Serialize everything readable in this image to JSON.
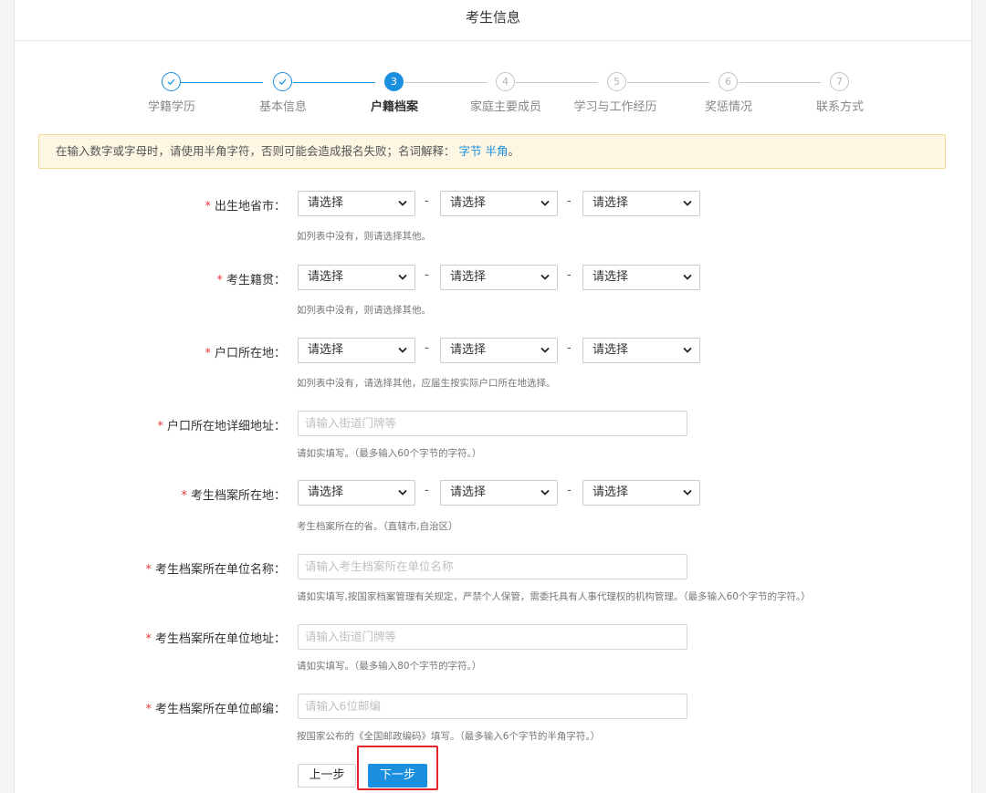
{
  "page": {
    "title": "考生信息"
  },
  "steps": [
    {
      "number": "1",
      "label": "学籍学历",
      "state": "done"
    },
    {
      "number": "2",
      "label": "基本信息",
      "state": "done"
    },
    {
      "number": "3",
      "label": "户籍档案",
      "state": "current"
    },
    {
      "number": "4",
      "label": "家庭主要成员",
      "state": "todo"
    },
    {
      "number": "5",
      "label": "学习与工作经历",
      "state": "todo"
    },
    {
      "number": "6",
      "label": "奖惩情况",
      "state": "todo"
    },
    {
      "number": "7",
      "label": "联系方式",
      "state": "todo"
    }
  ],
  "notice": {
    "text": "在输入数字或字母时，请使用半角字符，否则可能会造成报名失败；名词解释：",
    "link1": "字节",
    "link2": "半角",
    "end": "。"
  },
  "form": {
    "required_mark": "*",
    "select_placeholder": "请选择",
    "separator": "-",
    "birthplace": {
      "label": "出生地省市：",
      "help": "如列表中没有，则请选择其他。"
    },
    "native_place": {
      "label": "考生籍贯：",
      "help": "如列表中没有，则请选择其他。"
    },
    "hukou": {
      "label": "户口所在地：",
      "help": "如列表中没有，请选择其他，应届生按实际户口所在地选择。"
    },
    "hukou_address": {
      "label": "户口所在地详细地址：",
      "placeholder": "请输入街道门牌等",
      "help": "请如实填写。（最多输入60个字节的字符。）"
    },
    "archive_location": {
      "label": "考生档案所在地：",
      "help": "考生档案所在的省。（直辖市,自治区）"
    },
    "archive_unit_name": {
      "label": "考生档案所在单位名称：",
      "placeholder": "请输入考生档案所在单位名称",
      "help": "请如实填写,按国家档案管理有关规定，严禁个人保管，需委托具有人事代理权的机构管理。（最多输入60个字节的字符。）"
    },
    "archive_unit_address": {
      "label": "考生档案所在单位地址：",
      "placeholder": "请输入街道门牌等",
      "help": "请如实填写。（最多输入80个字节的字符。）"
    },
    "archive_unit_postcode": {
      "label": "考生档案所在单位邮编：",
      "placeholder": "请输入6位邮编",
      "help": "按国家公布的《全国邮政编码》填写。（最多输入6个字节的半角字符。）"
    }
  },
  "buttons": {
    "prev": "上一步",
    "next": "下一步"
  },
  "colors": {
    "accent": "#1a8fe0",
    "required": "#e4393c",
    "notice_bg": "#fdf6e3",
    "highlight": "#e2242c"
  },
  "icons": {
    "done_step": "check-icon",
    "select_arrow": "chevron-down-icon"
  }
}
